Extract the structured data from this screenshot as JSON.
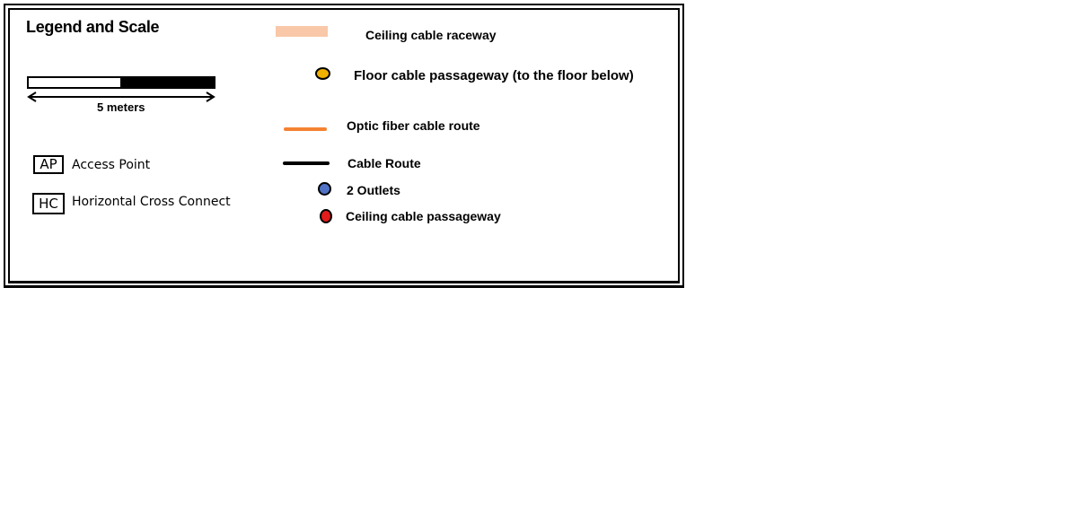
{
  "legend": {
    "title": "Legend and Scale",
    "scale": {
      "label": "5 meters"
    },
    "access_point": {
      "symbol": "AP",
      "label": "Access Point"
    },
    "cross_connect": {
      "symbol": "HC",
      "label": "Horizontal Cross Connect"
    },
    "items": {
      "ceiling_raceway": {
        "label": "Ceiling cable raceway",
        "color": "#f8c8a8"
      },
      "floor_passageway": {
        "label": "Floor cable passageway (to the floor below)",
        "color": "#f0b000"
      },
      "optic_fiber": {
        "label": "Optic fiber cable route",
        "color": "#f58232"
      },
      "cable_route": {
        "label": "Cable Route",
        "color": "#000000"
      },
      "outlets": {
        "label": "2 Outlets",
        "color": "#4f72c4"
      },
      "ceiling_passageway": {
        "label": "Ceiling cable passageway",
        "color": "#e21b1b"
      }
    }
  }
}
